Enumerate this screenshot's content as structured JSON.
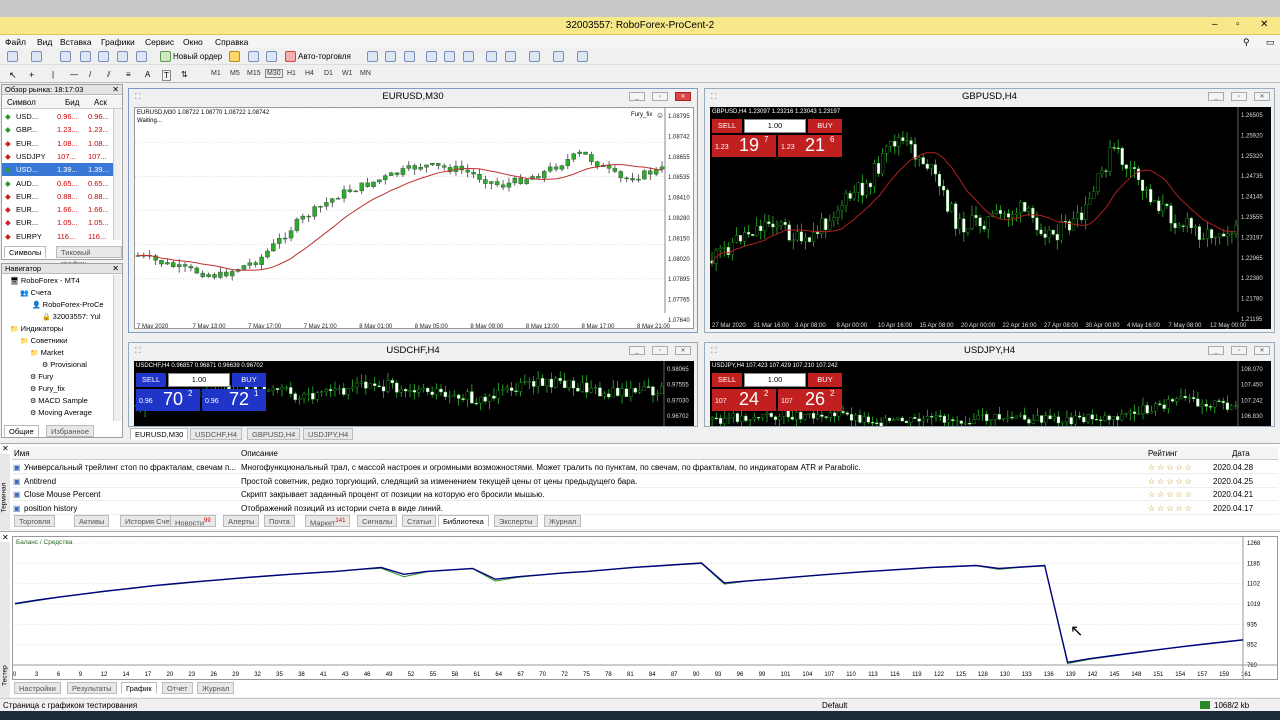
{
  "window": {
    "title": "32003557: RoboForex-ProCent-2"
  },
  "menu": [
    "Файл",
    "Вид",
    "Вставка",
    "Графики",
    "Сервис",
    "Окно",
    "Справка"
  ],
  "toolbar": {
    "new_order": "Новый ордер",
    "autotrading": "Авто-торговля"
  },
  "timeframes": [
    "M1",
    "M5",
    "M15",
    "M30",
    "H1",
    "H4",
    "D1",
    "W1",
    "MN"
  ],
  "market_watch": {
    "title": "Обзор рынка: 18:17:03",
    "col_symbol": "Символ",
    "col_bid": "Бид",
    "col_ask": "Аск",
    "rows": [
      {
        "symbol": "USD...",
        "bid": "0.96...",
        "ask": "0.96...",
        "up": true
      },
      {
        "symbol": "GBP...",
        "bid": "1.23...",
        "ask": "1.23...",
        "up": true
      },
      {
        "symbol": "EUR...",
        "bid": "1.08...",
        "ask": "1.08...",
        "up": false
      },
      {
        "symbol": "USDJPY",
        "bid": "107...",
        "ask": "107...",
        "up": false
      },
      {
        "symbol": "USD...",
        "bid": "1.39...",
        "ask": "1.39...",
        "up": true,
        "selected": true
      },
      {
        "symbol": "AUD...",
        "bid": "0.65...",
        "ask": "0.65...",
        "up": true
      },
      {
        "symbol": "EUR...",
        "bid": "0.88...",
        "ask": "0.88...",
        "up": false
      },
      {
        "symbol": "EUR...",
        "bid": "1.66...",
        "ask": "1.66...",
        "up": false
      },
      {
        "symbol": "EUR...",
        "bid": "1.05...",
        "ask": "1.05...",
        "up": false
      },
      {
        "symbol": "EURPY",
        "bid": "116...",
        "ask": "116...",
        "up": false
      }
    ],
    "tabs": [
      "Символы",
      "Тиковый график"
    ]
  },
  "navigator": {
    "title": "Навигатор",
    "items": [
      "RoboForex - MT4",
      "Счета",
      "RoboForex-ProCe",
      "32003557: Yul",
      "Индикаторы",
      "Советники",
      "Market",
      "Provisional",
      "Fury",
      "Fury_fix",
      "MACD Sample",
      "Moving Average"
    ],
    "tabs": [
      "Общие",
      "Избранное"
    ]
  },
  "charts": {
    "eurusd": {
      "title": "EURUSD,M30",
      "info": "EURUSD,M30  1.08722 1.08770 1.08722 1.08742",
      "status": "Waiting...",
      "ea": "Fury_fix",
      "prices": [
        "1.08795",
        "1.08742",
        "1.08655",
        "1.08535",
        "1.08410",
        "1.08280",
        "1.08150",
        "1.08020",
        "1.07895",
        "1.07765",
        "1.07640"
      ],
      "times": [
        "7 May 2020",
        "7 May 13:00",
        "7 May 17:00",
        "7 May 21:00",
        "8 May 01:00",
        "8 May 05:00",
        "8 May 09:00",
        "8 May 13:00",
        "8 May 17:00",
        "8 May 21:00"
      ]
    },
    "gbpusd": {
      "title": "GBPUSD,H4",
      "info": "GBPUSD,H4  1.23097 1.23216 1.23043 1.23197",
      "sell": "SELL",
      "buy": "BUY",
      "lot": "1.00",
      "bid_pre": "1.23",
      "bid_big": "19",
      "bid_sup": "7",
      "ask_pre": "1.23",
      "ask_big": "21",
      "ask_sup": "6",
      "prices": [
        "1.26505",
        "1.25920",
        "1.25320",
        "1.24735",
        "1.24145",
        "1.23555",
        "1.23197",
        "1.22965",
        "1.22380",
        "1.21780",
        "1.21195"
      ],
      "times": [
        "27 Mar 2020",
        "31 Mar 16:00",
        "3 Apr 08:00",
        "8 Apr 00:00",
        "10 Apr 16:00",
        "15 Apr 08:00",
        "20 Apr 00:00",
        "22 Apr 16:00",
        "27 Apr 08:00",
        "30 Apr 00:00",
        "4 May 16:00",
        "7 May 08:00",
        "12 May 00:00"
      ]
    },
    "usdchf": {
      "title": "USDCHF,H4",
      "info": "USDCHF,H4  0.96857 0.96871 0.96639 0.96702",
      "sell": "SELL",
      "buy": "BUY",
      "lot": "1.00",
      "bid_pre": "0.96",
      "bid_big": "70",
      "bid_sup": "2",
      "ask_pre": "0.96",
      "ask_big": "72",
      "ask_sup": "1",
      "prices": [
        "0.98065",
        "0.97555",
        "0.97030",
        "0.96702"
      ]
    },
    "usdjpy": {
      "title": "USDJPY,H4",
      "info": "USDJPY,H4  107.423 107.429 107.210 107.242",
      "sell": "SELL",
      "buy": "BUY",
      "lot": "1.00",
      "bid_pre": "107",
      "bid_big": "24",
      "bid_sup": "2",
      "ask_pre": "107",
      "ask_big": "26",
      "ask_sup": "2",
      "prices": [
        "108.070",
        "107.450",
        "107.242",
        "106.830"
      ]
    }
  },
  "chart_tabs": [
    "EURUSD,M30",
    "USDCHF,H4",
    "GBPUSD,H4",
    "USDJPY,H4"
  ],
  "terminal": {
    "col_name": "Имя",
    "col_desc": "Описание",
    "col_rating": "Рейтинг",
    "col_date": "Дата",
    "rows": [
      {
        "name": "Универсальный трейлинг стоп по фракталам, свечам п...",
        "desc": "Многофункциональный трал, с массой настроек и огромными возможностями. Может тралить по пунктам, по свечам, по фракталам, по индикаторам ATR и Parabolic.",
        "date": "2020.04.28"
      },
      {
        "name": "Antitrend",
        "desc": "Простой советник, редко торгующий, следящий за изменением текущей цены от цены предыдущего бара.",
        "date": "2020.04.25"
      },
      {
        "name": "Close Mouse Percent",
        "desc": "Скрипт закрывает заданный процент от позиции на которую его бросили мышью.",
        "date": "2020.04.21"
      },
      {
        "name": "position history",
        "desc": "Отображений позиций из истории счета в виде линий.",
        "date": "2020.04.17"
      }
    ],
    "stars": "☆☆☆☆☆",
    "side_label": "Терминал",
    "tabs": [
      "Торговля",
      "Активы",
      "История Счета",
      "Новости",
      "Алерты",
      "Почта",
      "Маркет",
      "Сигналы",
      "Статьи",
      "Библиотека",
      "Эксперты",
      "Журнал"
    ],
    "news_badge": "99",
    "market_badge": "141"
  },
  "tester": {
    "legend": "Баланс / Средства",
    "side_label": "Тестер",
    "tabs": [
      "Настройки",
      "Результаты",
      "График",
      "Отчет",
      "Журнал"
    ]
  },
  "chart_data": {
    "type": "line",
    "title": "",
    "ylim": [
      769,
      1268
    ],
    "yticks": [
      1268,
      1185,
      1102,
      1019,
      935,
      852,
      769
    ],
    "x": [
      0,
      3,
      6,
      9,
      12,
      15,
      18,
      21,
      24,
      27,
      30,
      33,
      36,
      39,
      42,
      45,
      48,
      51,
      54,
      57,
      60,
      63,
      66,
      69,
      72,
      75,
      78,
      81,
      84,
      87,
      90,
      93,
      96,
      99,
      102,
      105,
      108,
      111,
      114,
      117,
      120,
      123,
      126,
      129,
      132,
      135,
      138,
      141,
      144,
      147,
      150,
      153,
      156,
      159,
      161
    ],
    "series": [
      {
        "name": "Баланс",
        "color": "#000080",
        "values": [
          1020,
          1035,
          1048,
          1060,
          1072,
          1082,
          1093,
          1102,
          1110,
          1118,
          1126,
          1133,
          1140,
          1146,
          1152,
          1160,
          1168,
          1140,
          1152,
          1158,
          1164,
          1120,
          1130,
          1138,
          1146,
          1152,
          1160,
          1168,
          1174,
          1180,
          1186,
          1105,
          1113,
          1120,
          1128,
          1136,
          1143,
          1150,
          1156,
          1162,
          1168,
          1172,
          1176,
          1164,
          1170,
          1176,
          780,
          795,
          808,
          820,
          832,
          844,
          855,
          865,
          872
        ]
      },
      {
        "name": "Средства",
        "color": "#2e8b2e",
        "values": [
          1018,
          1033,
          1047,
          1059,
          1070,
          1081,
          1092,
          1100,
          1109,
          1117,
          1125,
          1132,
          1139,
          1145,
          1151,
          1159,
          1165,
          1130,
          1150,
          1157,
          1163,
          1112,
          1128,
          1137,
          1145,
          1151,
          1159,
          1167,
          1173,
          1179,
          1184,
          1100,
          1112,
          1119,
          1127,
          1135,
          1142,
          1149,
          1155,
          1161,
          1167,
          1171,
          1175,
          1160,
          1169,
          1174,
          775,
          793,
          806,
          819,
          831,
          843,
          854,
          864,
          871
        ]
      }
    ],
    "xticks": [
      "0",
      "3",
      "6",
      "9",
      "12",
      "14",
      "17",
      "20",
      "23",
      "26",
      "29",
      "32",
      "35",
      "38",
      "41",
      "43",
      "46",
      "49",
      "52",
      "55",
      "58",
      "61",
      "64",
      "67",
      "70",
      "72",
      "75",
      "78",
      "81",
      "84",
      "87",
      "90",
      "93",
      "96",
      "99",
      "101",
      "104",
      "107",
      "110",
      "113",
      "116",
      "119",
      "122",
      "125",
      "128",
      "130",
      "133",
      "136",
      "139",
      "142",
      "145",
      "148",
      "151",
      "154",
      "157",
      "159",
      "161"
    ]
  },
  "status": {
    "left": "Страница с графиком тестирования",
    "mid": "Default",
    "right": "1068/2 kb"
  }
}
